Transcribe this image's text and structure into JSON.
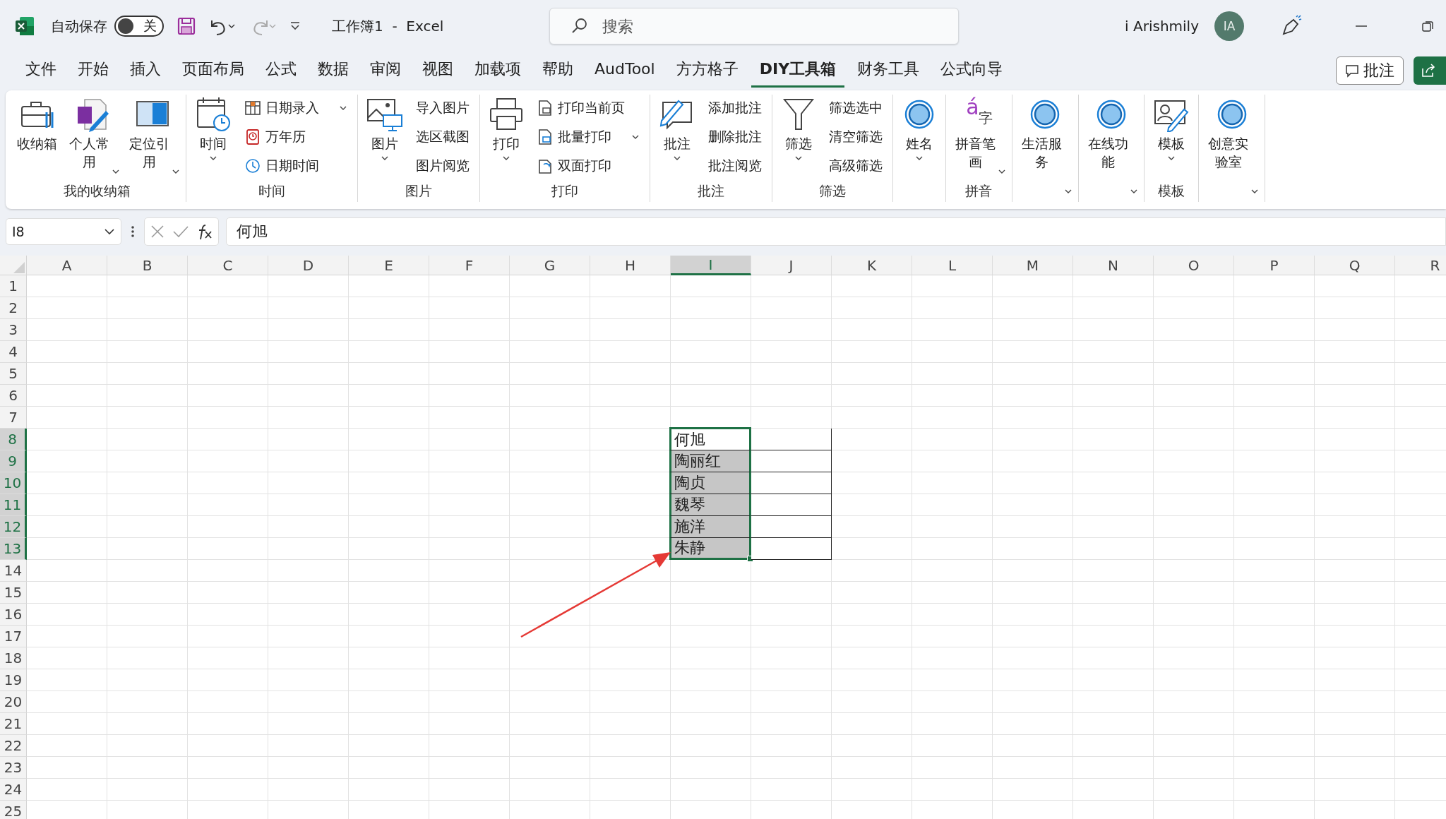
{
  "title_bar": {
    "autosave_label": "自动保存",
    "autosave_toggle": {
      "label": "关",
      "on": false
    },
    "undo_enabled": true,
    "redo_enabled": false,
    "title": "工作簿1  -  Excel",
    "search": {
      "placeholder": "搜索"
    },
    "user_name": "i Arishmily",
    "avatar": "IA"
  },
  "menu_tabs": [
    {
      "label": "文件",
      "selected": false
    },
    {
      "label": "开始",
      "selected": false
    },
    {
      "label": "插入",
      "selected": false
    },
    {
      "label": "页面布局",
      "selected": false
    },
    {
      "label": "公式",
      "selected": false
    },
    {
      "label": "数据",
      "selected": false
    },
    {
      "label": "审阅",
      "selected": false
    },
    {
      "label": "视图",
      "selected": false
    },
    {
      "label": "加载项",
      "selected": false
    },
    {
      "label": "帮助",
      "selected": false
    },
    {
      "label": "AudTool",
      "selected": false
    },
    {
      "label": "方方格子",
      "selected": false
    },
    {
      "label": "DIY工具箱",
      "selected": true
    },
    {
      "label": "财务工具",
      "selected": false
    },
    {
      "label": "公式向导",
      "selected": false
    }
  ],
  "comments_button": "批注",
  "ribbon": [
    {
      "label": "我的收纳箱",
      "items": [
        {
          "kind": "large",
          "label": "收纳箱",
          "dropdown": false
        },
        {
          "kind": "large",
          "label": "个人常用",
          "dropdown": true
        },
        {
          "kind": "large",
          "label": "定位引用",
          "dropdown": true
        }
      ]
    },
    {
      "label": "时间",
      "items": [
        {
          "kind": "large",
          "label": "时间",
          "dropdown": true
        },
        {
          "kind": "small",
          "label": "日期录入",
          "dropdown": true
        },
        {
          "kind": "small",
          "label": "万年历",
          "dropdown": false
        },
        {
          "kind": "small",
          "label": "日期时间",
          "dropdown": false
        }
      ]
    },
    {
      "label": "图片",
      "items": [
        {
          "kind": "large",
          "label": "图片",
          "dropdown": true
        },
        {
          "kind": "small",
          "label": "导入图片",
          "dropdown": false
        },
        {
          "kind": "small",
          "label": "选区截图",
          "dropdown": false
        },
        {
          "kind": "small",
          "label": "图片阅览",
          "dropdown": false
        }
      ]
    },
    {
      "label": "打印",
      "items": [
        {
          "kind": "large",
          "label": "打印",
          "dropdown": true
        },
        {
          "kind": "small",
          "label": "打印当前页",
          "dropdown": false
        },
        {
          "kind": "small",
          "label": "批量打印",
          "dropdown": true
        },
        {
          "kind": "small",
          "label": "双面打印",
          "dropdown": false
        }
      ]
    },
    {
      "label": "批注",
      "items": [
        {
          "kind": "large",
          "label": "批注",
          "dropdown": true
        },
        {
          "kind": "small",
          "label": "添加批注",
          "dropdown": false
        },
        {
          "kind": "small",
          "label": "删除批注",
          "dropdown": false
        },
        {
          "kind": "small",
          "label": "批注阅览",
          "dropdown": false
        }
      ]
    },
    {
      "label": "筛选",
      "items": [
        {
          "kind": "large",
          "label": "筛选",
          "dropdown": true
        },
        {
          "kind": "small",
          "label": "筛选选中",
          "dropdown": false
        },
        {
          "kind": "small",
          "label": "清空筛选",
          "dropdown": false
        },
        {
          "kind": "small",
          "label": "高级筛选",
          "dropdown": false
        }
      ]
    },
    {
      "items": [
        {
          "kind": "large",
          "label": "姓名",
          "dropdown": true
        }
      ]
    },
    {
      "label": "拼音",
      "items": [
        {
          "kind": "large",
          "label": "拼音笔画",
          "dropdown": true,
          "glyphs": [
            "á",
            "字"
          ]
        }
      ]
    },
    {
      "items": [
        {
          "kind": "large",
          "label": "生活服务",
          "dropdown": true
        }
      ]
    },
    {
      "items": [
        {
          "kind": "large",
          "label": "在线功能",
          "dropdown": true
        }
      ]
    },
    {
      "label": "模板",
      "items": [
        {
          "kind": "large",
          "label": "模板",
          "dropdown": true
        }
      ]
    },
    {
      "items": [
        {
          "kind": "large",
          "label": "创意实验室",
          "dropdown": true
        }
      ]
    }
  ],
  "formula_bar": {
    "name_box": "I8",
    "formula": "何旭"
  },
  "sheet": {
    "columns": [
      {
        "label": "A",
        "selected": false
      },
      {
        "label": "B",
        "selected": false
      },
      {
        "label": "C",
        "selected": false
      },
      {
        "label": "D",
        "selected": false
      },
      {
        "label": "E",
        "selected": false
      },
      {
        "label": "F",
        "selected": false
      },
      {
        "label": "G",
        "selected": false
      },
      {
        "label": "H",
        "selected": false
      },
      {
        "label": "I",
        "selected": true
      },
      {
        "label": "J",
        "selected": false
      },
      {
        "label": "K",
        "selected": false
      },
      {
        "label": "L",
        "selected": false
      },
      {
        "label": "M",
        "selected": false
      },
      {
        "label": "N",
        "selected": false
      },
      {
        "label": "O",
        "selected": false
      },
      {
        "label": "P",
        "selected": false
      },
      {
        "label": "Q",
        "selected": false
      },
      {
        "label": "R",
        "selected": false
      }
    ],
    "rows": [
      {
        "label": "1",
        "selected": false
      },
      {
        "label": "2",
        "selected": false
      },
      {
        "label": "3",
        "selected": false
      },
      {
        "label": "4",
        "selected": false
      },
      {
        "label": "5",
        "selected": false
      },
      {
        "label": "6",
        "selected": false
      },
      {
        "label": "7",
        "selected": false
      },
      {
        "label": "8",
        "selected": true,
        "cells": [
          {
            "text": "何旭",
            "selected": false
          },
          {
            "selected": false
          }
        ]
      },
      {
        "label": "9",
        "selected": true,
        "cells": [
          {
            "text": "陶丽红",
            "selected": true
          },
          {
            "selected": false
          }
        ]
      },
      {
        "label": "10",
        "selected": true,
        "cells": [
          {
            "text": "陶贞",
            "selected": true
          },
          {
            "selected": false
          }
        ]
      },
      {
        "label": "11",
        "selected": true,
        "cells": [
          {
            "text": "魏琴",
            "selected": true
          },
          {
            "selected": false
          }
        ]
      },
      {
        "label": "12",
        "selected": true,
        "cells": [
          {
            "text": "施洋",
            "selected": true
          },
          {
            "selected": false
          }
        ]
      },
      {
        "label": "13",
        "selected": true,
        "cells": [
          {
            "text": "朱静",
            "selected": true
          },
          {
            "selected": false
          }
        ]
      },
      {
        "label": "14",
        "selected": false
      },
      {
        "label": "15",
        "selected": false
      },
      {
        "label": "16",
        "selected": false
      },
      {
        "label": "17",
        "selected": false
      },
      {
        "label": "18",
        "selected": false
      },
      {
        "label": "19",
        "selected": false
      },
      {
        "label": "20",
        "selected": false
      },
      {
        "label": "21",
        "selected": false
      },
      {
        "label": "22",
        "selected": false
      },
      {
        "label": "23",
        "selected": false
      },
      {
        "label": "24",
        "selected": false
      },
      {
        "label": "25",
        "selected": false
      }
    ]
  }
}
